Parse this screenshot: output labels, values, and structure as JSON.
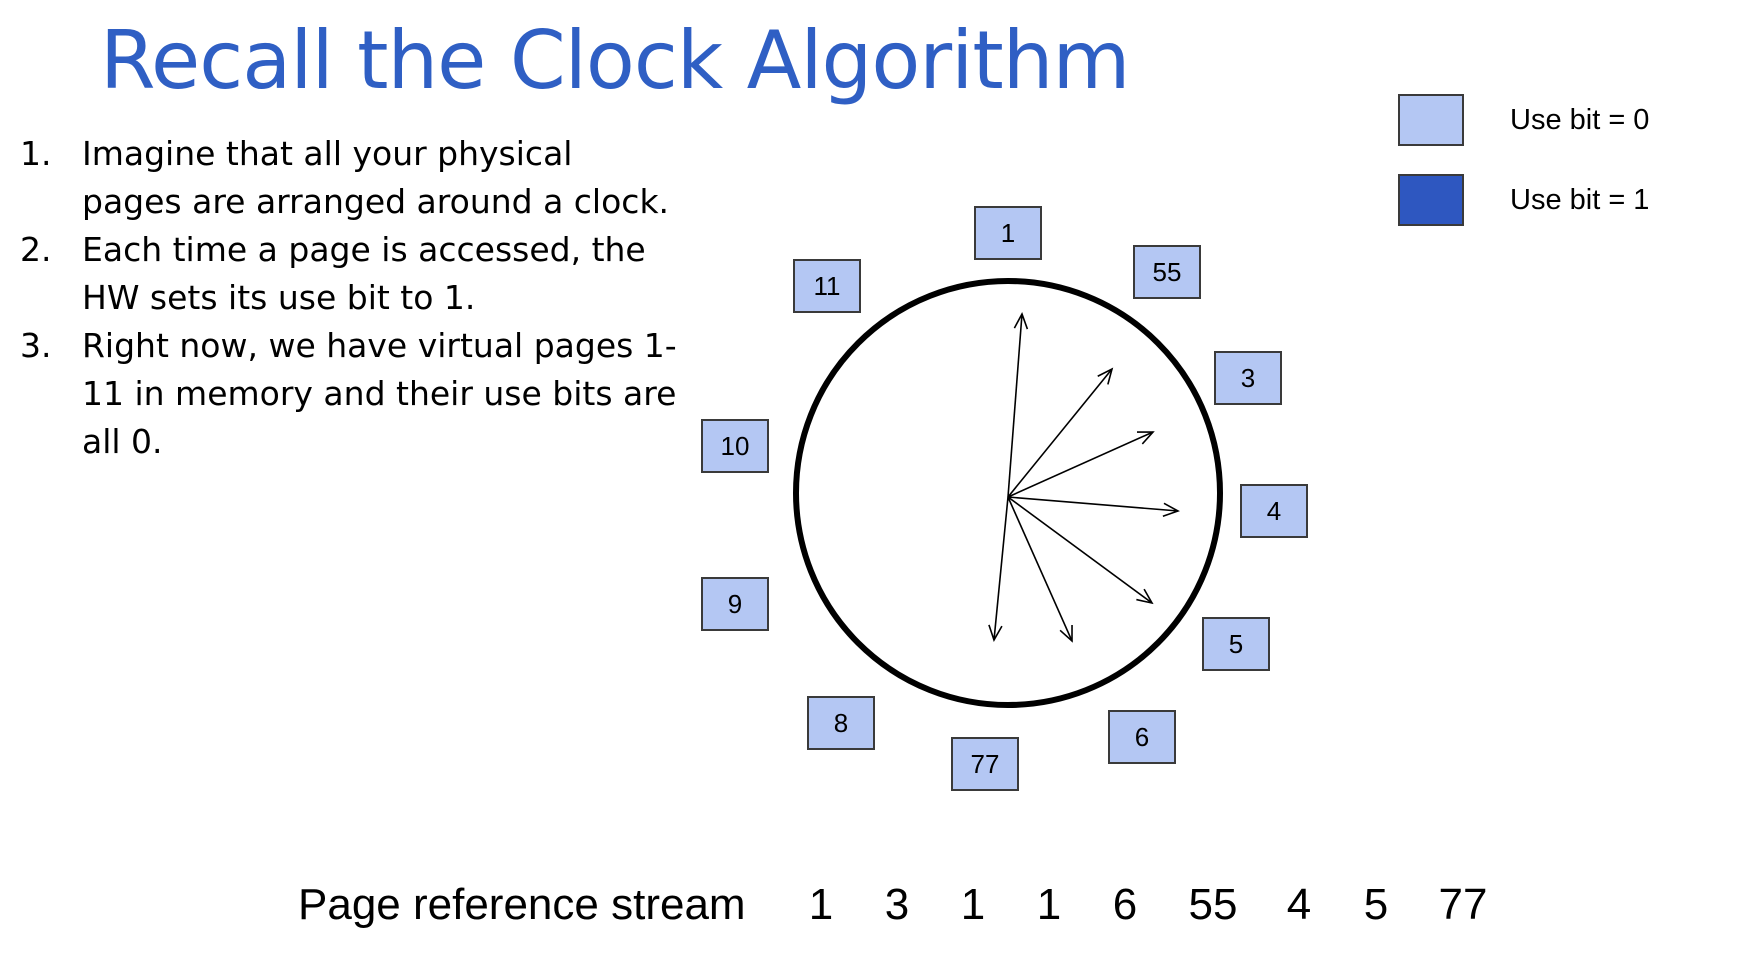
{
  "title": "Recall the Clock Algorithm",
  "steps": [
    {
      "number": "1.",
      "text": "Imagine that all your physical pages are arranged around a clock."
    },
    {
      "number": "2.",
      "text": "Each time a page is accessed, the HW sets its use bit to 1."
    },
    {
      "number": "3.",
      "text": "Right now, we have virtual pages 1-11 in memory and their use bits are all 0."
    }
  ],
  "legend": [
    {
      "label": "Use bit = 0",
      "color": "#b4c7f3"
    },
    {
      "label": "Use bit = 1",
      "color": "#2e57c0"
    }
  ],
  "clock_pages": [
    {
      "label": "1",
      "use_bit": 0
    },
    {
      "label": "55",
      "use_bit": 0
    },
    {
      "label": "3",
      "use_bit": 0
    },
    {
      "label": "4",
      "use_bit": 0
    },
    {
      "label": "5",
      "use_bit": 0
    },
    {
      "label": "6",
      "use_bit": 0
    },
    {
      "label": "77",
      "use_bit": 0
    },
    {
      "label": "8",
      "use_bit": 0
    },
    {
      "label": "9",
      "use_bit": 0
    },
    {
      "label": "10",
      "use_bit": 0
    },
    {
      "label": "11",
      "use_bit": 0
    }
  ],
  "clock_hands": 7,
  "stream": {
    "label": "Page reference stream",
    "refs": [
      "1",
      "3",
      "1",
      "1",
      "6",
      "55",
      "4",
      "5",
      "77"
    ]
  },
  "colors": {
    "title": "#2f5fc4",
    "page_fill_use0": "#b4c7f3",
    "page_fill_use1": "#2e57c0"
  }
}
